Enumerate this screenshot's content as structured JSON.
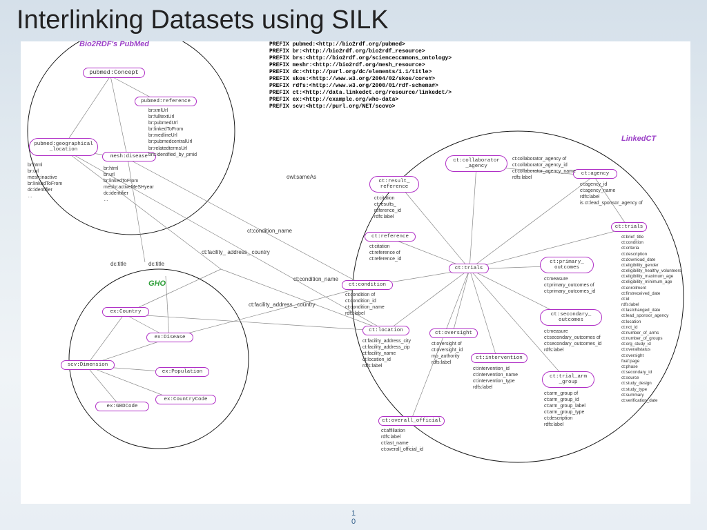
{
  "title": "Interlinking Datasets using SILK",
  "page_number_top": "1",
  "page_number_bottom": "0",
  "prefixes": "PREFIX pubmed:<http://bio2rdf.org/pubmed>\nPREFIX br:<http://bio2rdf.org/bio2rdf_resource>\nPREFIX brs:<http://bio2rdf.org/scienceccmmons_ontology>\nPREFIX meshr:<http://bio2rdf.org/mesh_resource>\nPREFIX dc:<http://purl.org/dc/elements/1.1/title>\nPREFIX skos:<http://www.w3.org/2004/02/skos/core#>\nPREFIX rdfs:<http://www.w3.org/2000/01/rdf-schema#>\nPREFIX ct:<http://data.linkedct.org/resource/linkedct/>\nPREFIX ex:<http://example.org/who-data>\nPREFIX scv:<http://purl.org/NET/scovo>",
  "groups": {
    "bio2rdf": "Bio2RDF's PubMed",
    "gho": "GHO",
    "linkedct": "LinkedCT"
  },
  "nodes": {
    "pubmed_concept": "pubmed:Concept",
    "pubmed_reference": "pubmed:reference",
    "pubmed_geo": "pubmed:geographical\n_location",
    "mesh_disease": "mesh:disease",
    "ex_country": "ex:Country",
    "ex_disease": "ex:Disease",
    "scv_dimension": "scv:Dimension",
    "ex_population": "ex:Population",
    "ex_gbdcode": "ex:GBDCode",
    "ex_countrycode": "ex:CountryCode",
    "ct_collab": "ct:collaborator\n_agency",
    "ct_result_ref": "ct:result_\nreference",
    "ct_agency": "ct:agency",
    "ct_reference": "ct:reference",
    "ct_trials_center": "ct:trials",
    "ct_trials_right": "ct:trials",
    "ct_condition": "ct:condition",
    "ct_primary": "ct:primary_\noutcomes",
    "ct_secondary": "ct:secondary_\noutcomes",
    "ct_location": "ct:location",
    "ct_oversight": "ct:oversight",
    "ct_intervention": "ct:intervention",
    "ct_overall": "ct:overall_official",
    "ct_trial_arm": "ct:trial_arm\n_group"
  },
  "attrs": {
    "pubmed_ref": "br:xmlUrl\nbr:fulltextUrl\nbr:pubmedUrl\nbr:linkedToFrom\nbr:medlineUrl\nbr:pubmedcentralUrl\nbr:relatedtermsUrl\nbrs:identified_by_pmid",
    "pubmed_geo": "br:html\nbr:url\nmesh:inactive\nbr:linkedToFrom\ndc:identifier\n…",
    "mesh_disease": "br:html\nbr:url\nbr:linkedToFrom\nmeshr:activeMeSHyear\ndc:identifier\n…",
    "ct_collab": "ct:collaborator_agency of\nct:collaborator_agency_id\nct:collaborator_agency_name\nrdfs:label",
    "ct_result_ref": "ct:citation\nct:results_\nreference_id\nrdfs:label",
    "ct_agency": "ct:agency_id\nct:agency_name\nrdfs:label\nis ct:lead_sponsor_agency of",
    "ct_reference": "ct:citation\nct:reference of\nct:reference_id",
    "ct_trials": "ct:brief_title\nct:condition\nct:criteria\nct:description\nct:download_date\nct:eligibility_gender\nct:eligibility_healthy_volunteers\nct:eligibility_maximum_age\nct:eligibility_minimum_age\nct:enrollment\nct:firstreceived_date\nct:id\nrdfs:label\nct:lastchanged_date\nct:lead_sponsor_agency\nct:location\nct:nct_id\nct:number_of_arms\nct:number_of_groups\nct:org_study_id\nct:overallstatus\nct:oversight\nfoaf:page\nct:phase\nct:secondary_id\nct:source\nct:study_design\nct:study_type\nct:summary\nct:verification_date",
    "ct_condition": "ct:condition of\nct:condition_id\nct:condition_name\nrdfs:label",
    "ct_primary": "ct:measure\nct:primary_outcomes of\nct:primary_outcomes_id",
    "ct_secondary": "ct:measure\nct:secondary_outcomes of\nct:secondary_outcomes_id\nrdfs:label",
    "ct_location": "ct:facility_address_city\nct:facility_address_zip\nct:facility_name\nct:location_id\nrdfs:label",
    "ct_oversight": "ct:oversight of\nct:oversight_id\nmo_authority\nrdfs:label",
    "ct_intervention": "ct:intervention_id\nct:intervention_name\nct:intervention_type\nrdfs:label",
    "ct_overall": "ct:affiliation\nrdfs:label\nct:last_name\nct:overall_official_id",
    "ct_trial_arm": "ct:arm_group of\nct:arm_group_id\nct:arm_group_label\nct:arm_group_type\nct:description\nrdfs:label"
  },
  "edge_labels": {
    "owl_sameas": "owl:sameAs",
    "dc_title1": "dc:title",
    "dc_title2": "dc:title",
    "ct_cond_name1": "ct:condition_name",
    "ct_cond_name2": "ct:condition_name",
    "ct_fac_addr": "ct:facility_\naddress_\ncountry",
    "ct_fac_addr2": "ct:facility_address\n_country"
  }
}
